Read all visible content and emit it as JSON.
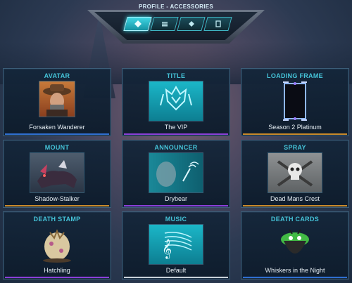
{
  "header": {
    "title_prefix": "PROFILE",
    "title_sep": " - ",
    "title_section": "ACCESSORIES"
  },
  "tabs": [
    {
      "icon": "diamond-icon",
      "active": true
    },
    {
      "icon": "menu-icon",
      "active": false
    },
    {
      "icon": "diamond-icon",
      "active": false
    },
    {
      "icon": "card-icon",
      "active": false
    }
  ],
  "cards": [
    {
      "label": "AVATAR",
      "name": "Forsaken Wanderer",
      "rarity_color": "#2f6fd0"
    },
    {
      "label": "TITLE",
      "name": "The VIP",
      "rarity_color": "#8a3fd8"
    },
    {
      "label": "LOADING FRAME",
      "name": "Season 2 Platinum",
      "rarity_color": "#c98a2a"
    },
    {
      "label": "MOUNT",
      "name": "Shadow-Stalker",
      "rarity_color": "#c98a2a"
    },
    {
      "label": "ANNOUNCER",
      "name": "Drybear",
      "rarity_color": "#8a3fd8"
    },
    {
      "label": "SPRAY",
      "name": "Dead Mans Crest",
      "rarity_color": "#c98a2a"
    },
    {
      "label": "DEATH STAMP",
      "name": "Hatchling",
      "rarity_color": "#8a3fd8"
    },
    {
      "label": "MUSIC",
      "name": "Default",
      "rarity_color": "#c9d2da"
    },
    {
      "label": "DEATH CARDS",
      "name": "Whiskers in the Night",
      "rarity_color": "#2f6fd0"
    }
  ]
}
